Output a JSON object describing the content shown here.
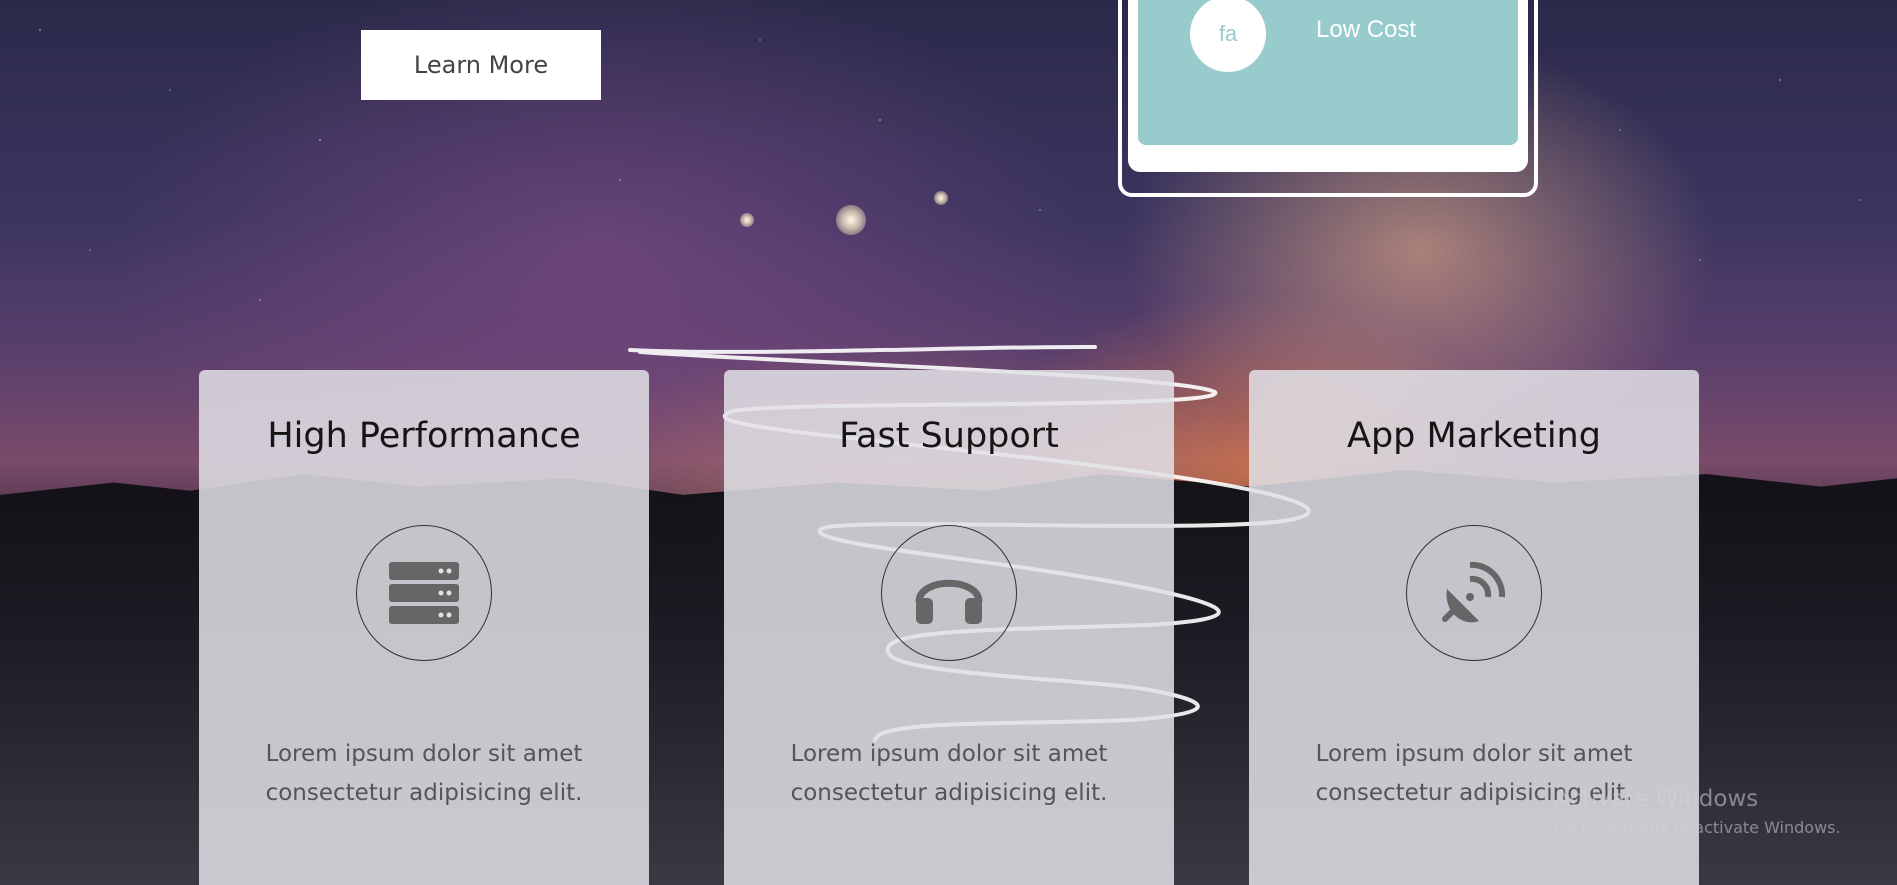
{
  "hero": {
    "learn_more_label": "Learn More"
  },
  "tablet": {
    "icon_text": "fa",
    "feature_label": "Low Cost"
  },
  "cards": [
    {
      "title": "High Performance",
      "icon": "server-icon",
      "line1": "Lorem ipsum dolor sit amet",
      "line2": "consectetur adipisicing elit."
    },
    {
      "title": "Fast Support",
      "icon": "headphones-icon",
      "line1": "Lorem ipsum dolor sit amet",
      "line2": "consectetur adipisicing elit."
    },
    {
      "title": "App Marketing",
      "icon": "satellite-dish-icon",
      "line1": "Lorem ipsum dolor sit amet",
      "line2": "consectetur adipisicing elit."
    }
  ],
  "watermark": {
    "title": "Activate Windows",
    "subtitle": "Go to Settings to activate Windows."
  },
  "colors": {
    "tablet_screen": "#98cbcb",
    "card_bg": "#e1e1e6",
    "icon_gray": "#666666"
  }
}
